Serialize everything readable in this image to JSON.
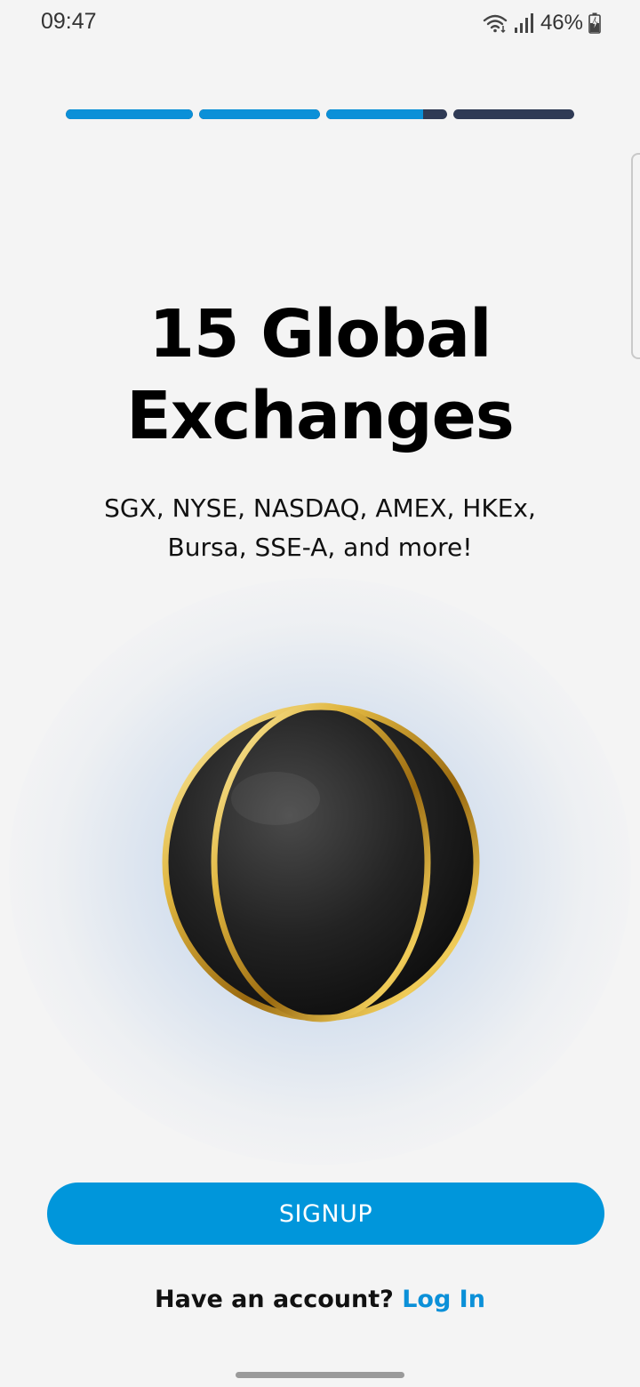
{
  "status_bar": {
    "time": "09:47",
    "battery": "46%",
    "icons": [
      "wifi-icon",
      "signal-icon",
      "battery-charging-icon"
    ]
  },
  "onboarding": {
    "progress_steps": [
      1.0,
      1.0,
      0.8,
      0.0
    ],
    "headline_line1": "15 Global",
    "headline_line2": "Exchanges",
    "subtitle_line1": "SGX, NYSE, NASDAQ, AMEX, HKEx,",
    "subtitle_line2": "Bursa, SSE-A, and more!",
    "illustration": "globe-icon"
  },
  "actions": {
    "signup_label": "SIGNUP",
    "have_account_text": "Have an account?",
    "login_label": "Log In"
  },
  "colors": {
    "accent": "#0096db",
    "progress_track": "#2f3a55",
    "background": "#f4f4f4"
  }
}
